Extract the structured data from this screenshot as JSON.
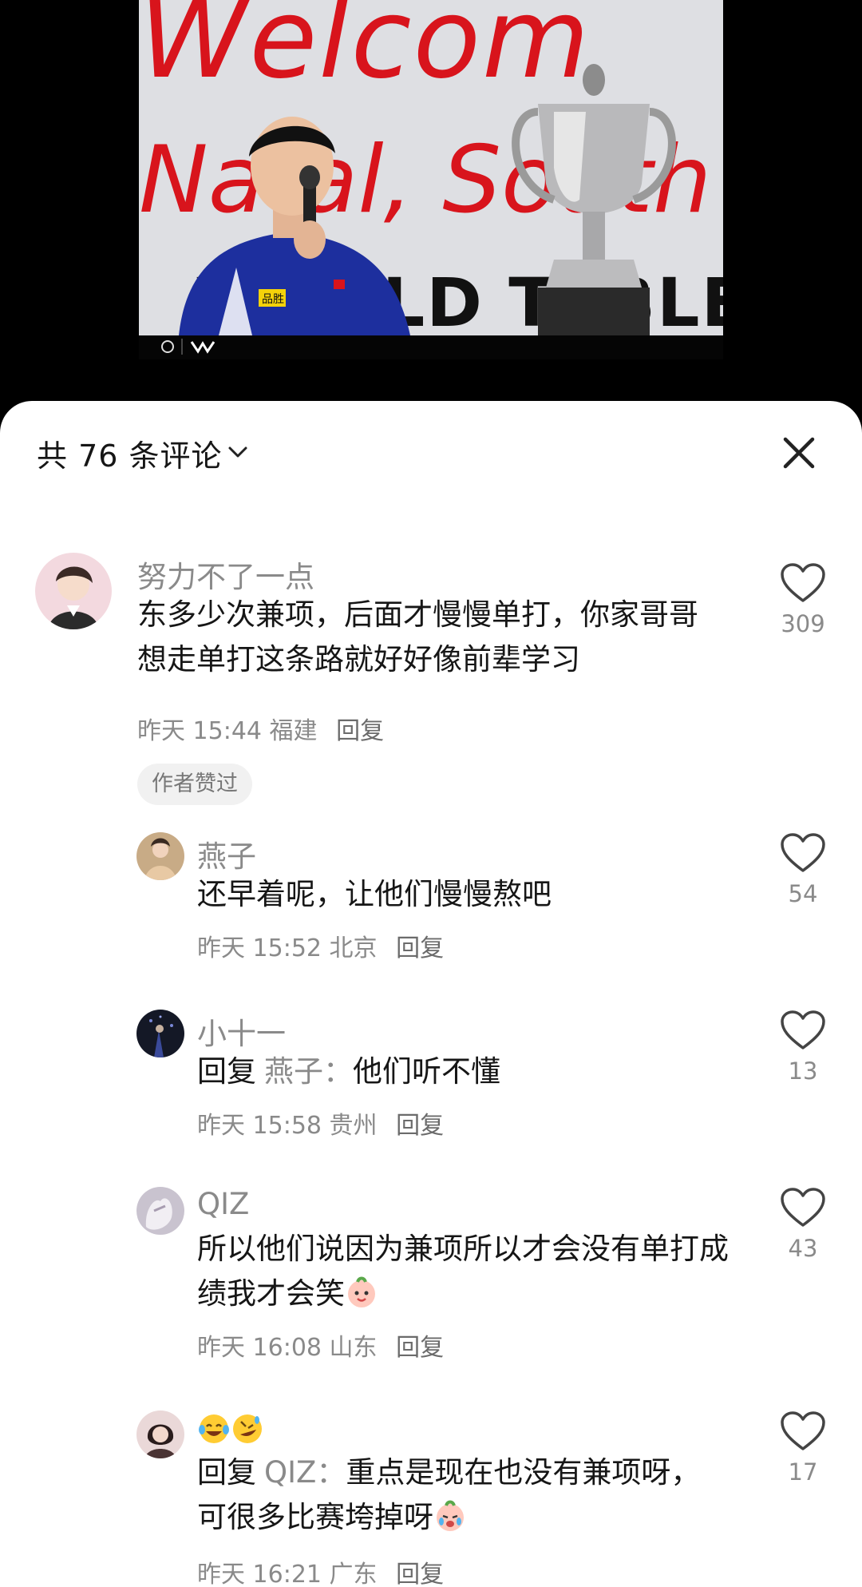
{
  "video": {
    "banner_line_1": "Welcom",
    "banner_line_2": "Natal, South",
    "banner_line_3": "WORLD TABLE",
    "shirt_logo": "品胜"
  },
  "sheet": {
    "title": "共 76 条评论",
    "icons": {
      "chevron": "chevron-down-icon",
      "close": "close-icon",
      "like": "heart-outline-icon"
    }
  },
  "comments": [
    {
      "nickname": "努力不了一点",
      "text": "东多少次兼项，后面才慢慢单打，你家哥哥想走单打这条路就好好像前辈学习",
      "time": "昨天 15:44",
      "location": "福建",
      "reply_label": "回复",
      "likes": "309",
      "badge": "作者赞过"
    },
    {
      "nickname": "燕子",
      "text": "还早着呢，让他们慢慢熬吧",
      "time": "昨天 15:52",
      "location": "北京",
      "reply_label": "回复",
      "likes": "54"
    },
    {
      "nickname": "小十一",
      "reply_prefix": "回复",
      "reply_target": "燕子：",
      "text": "他们听不懂",
      "time": "昨天 15:58",
      "location": "贵州",
      "reply_label": "回复",
      "likes": "13"
    },
    {
      "nickname": "QIZ",
      "text": "所以他们说因为兼项所以才会没有单打成绩我才会笑",
      "emoji": "smiling-face-emoji",
      "time": "昨天 16:08",
      "location": "山东",
      "reply_label": "回复",
      "likes": "43"
    },
    {
      "nickname_emojis": [
        "laughing-crying-emoji",
        "rolling-laughing-emoji"
      ],
      "reply_prefix": "回复",
      "reply_target": "QIZ：",
      "text": "重点是现在也没有兼项呀，可很多比赛垮掉呀",
      "emoji": "crying-face-emoji",
      "time": "昨天 16:21",
      "location": "广东",
      "reply_label": "回复",
      "likes": "17"
    }
  ]
}
